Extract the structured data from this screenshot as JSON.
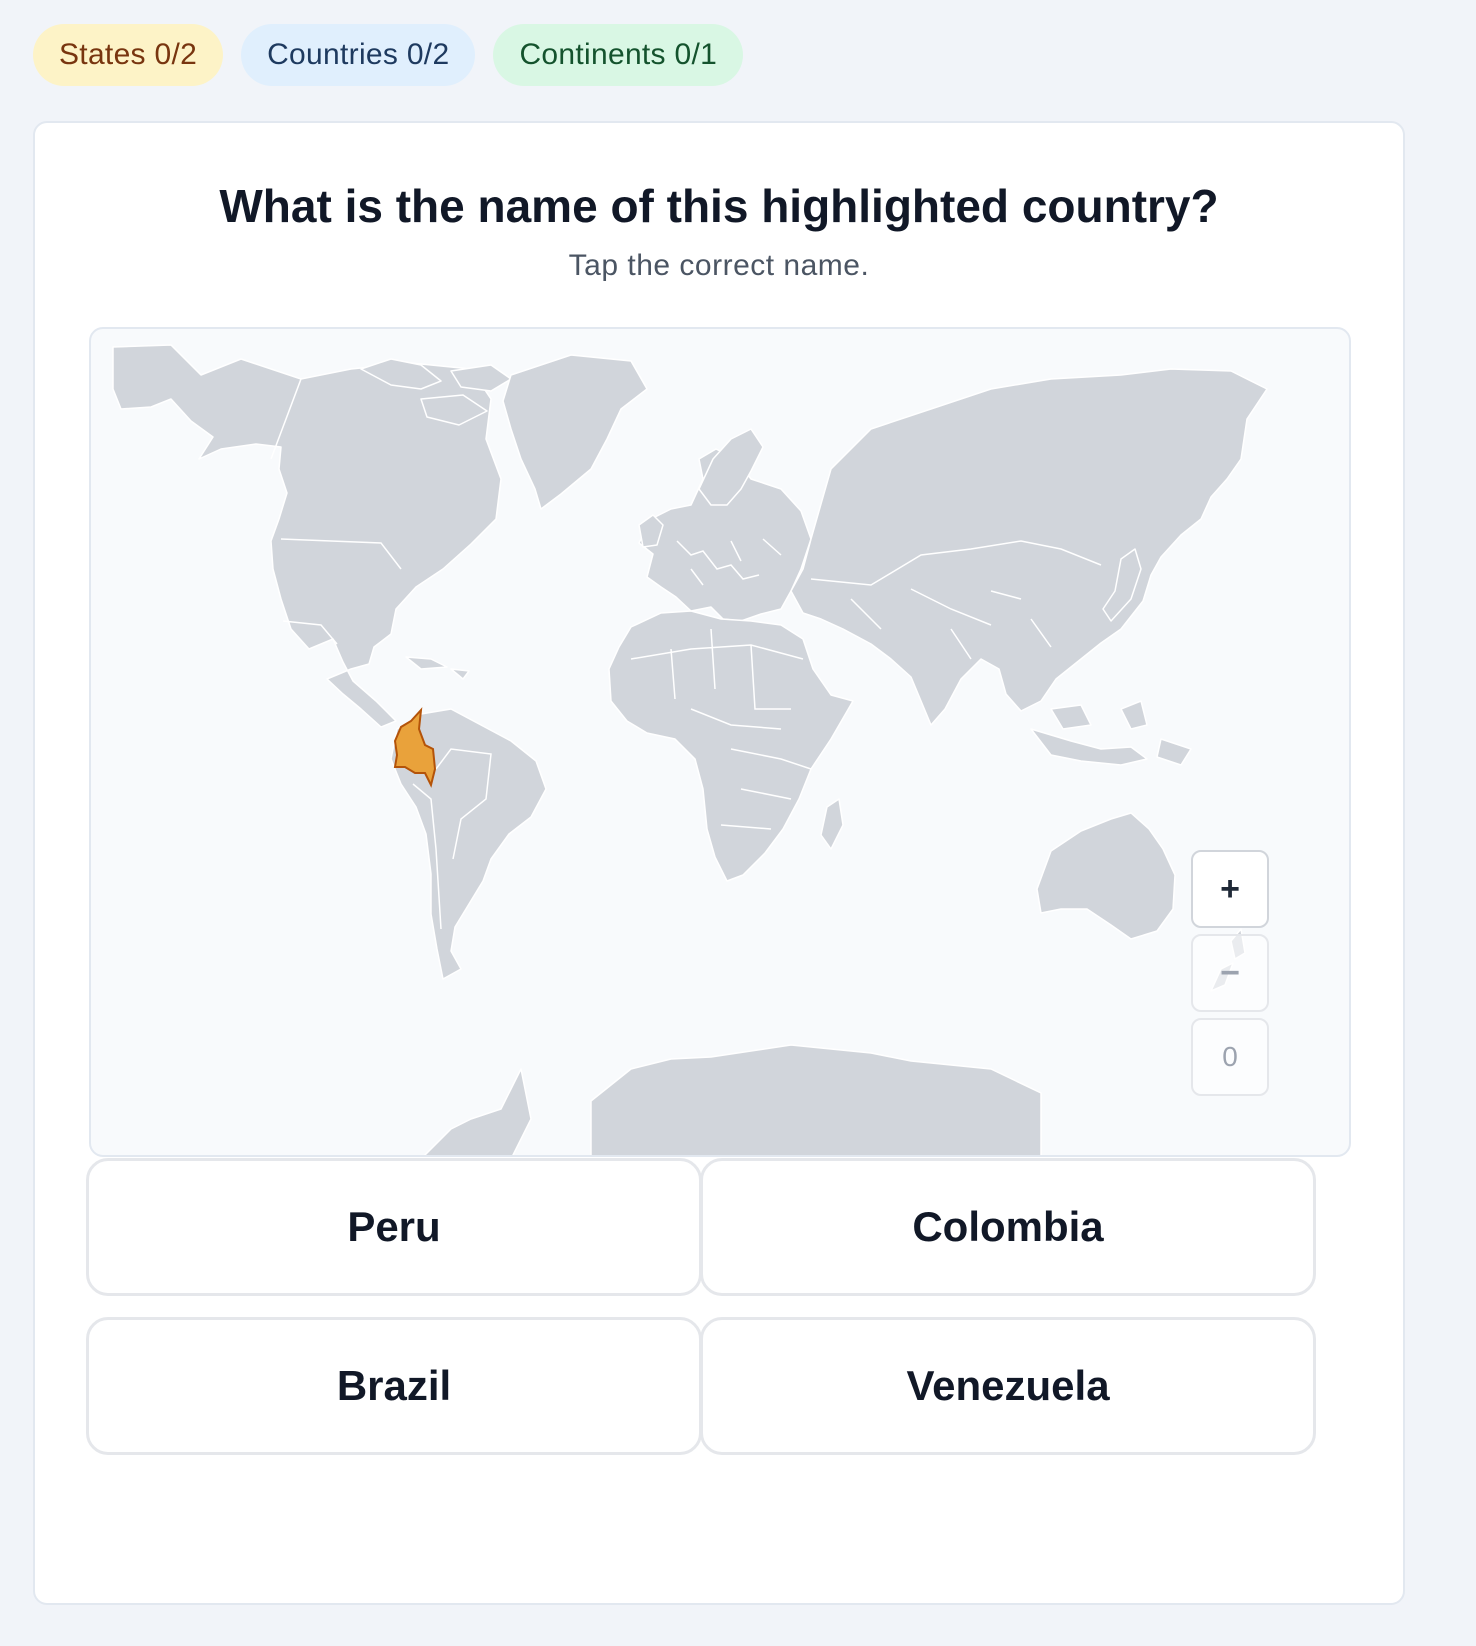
{
  "progress": {
    "states": "States 0/2",
    "countries": "Countries 0/2",
    "continents": "Continents 0/1"
  },
  "quiz": {
    "question": "What is the name of this highlighted country?",
    "hint": "Tap the correct name.",
    "highlighted_color": "#e9a23b",
    "options": [
      "Peru",
      "Colombia",
      "Brazil",
      "Venezuela"
    ]
  },
  "map": {
    "zoom_in_label": "+",
    "zoom_out_label": "−",
    "zoom_level": "0"
  }
}
